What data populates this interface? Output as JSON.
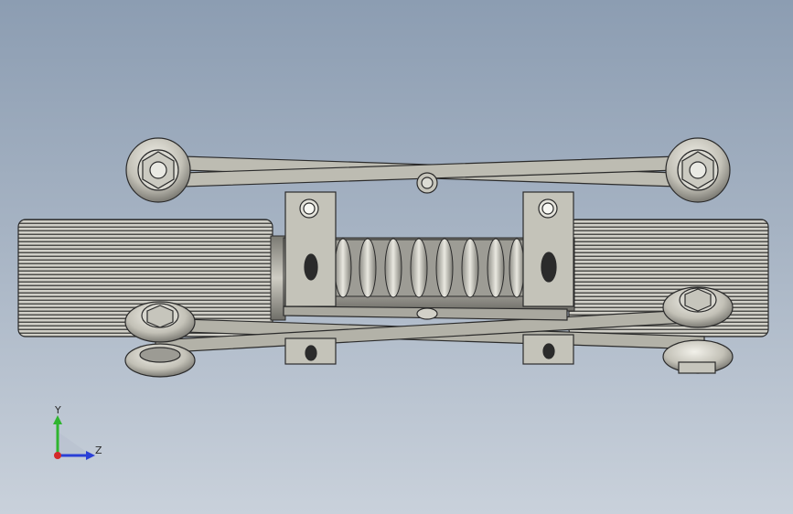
{
  "viewport": {
    "background_top": "#8c9db2",
    "background_bottom": "#c9d1db",
    "model_color": "#b9b8ae",
    "edge_color": "#2b2b2b"
  },
  "triad": {
    "y_label": "Y",
    "z_label": "Z",
    "y_color": "#2fb52f",
    "z_color": "#2a3fd6",
    "x_color": "#d42a2a"
  }
}
